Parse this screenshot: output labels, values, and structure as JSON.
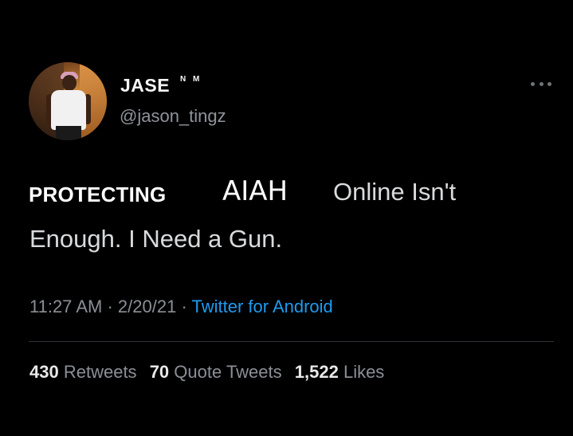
{
  "author": {
    "display_name": "JASE",
    "display_suffix": "N M",
    "handle": "@jason_tingz"
  },
  "tweet": {
    "overlay_word": "PROTECTING",
    "overlay_name": "AIAH",
    "text_line_1": "Online Isn't",
    "text_line_2": "Enough. I Need a Gun.",
    "time": "11:27 AM",
    "separator": "·",
    "date": "2/20/21",
    "source": "Twitter for Android"
  },
  "stats": {
    "retweets_count": "430",
    "retweets_label": "Retweets",
    "quote_count": "70",
    "quote_label": "Quote Tweets",
    "likes_count": "1,522",
    "likes_label": "Likes"
  },
  "icons": {
    "more": "more-icon"
  },
  "colors": {
    "background": "#000000",
    "link": "#1d9bf0",
    "secondary_text": "#8b8f95"
  }
}
